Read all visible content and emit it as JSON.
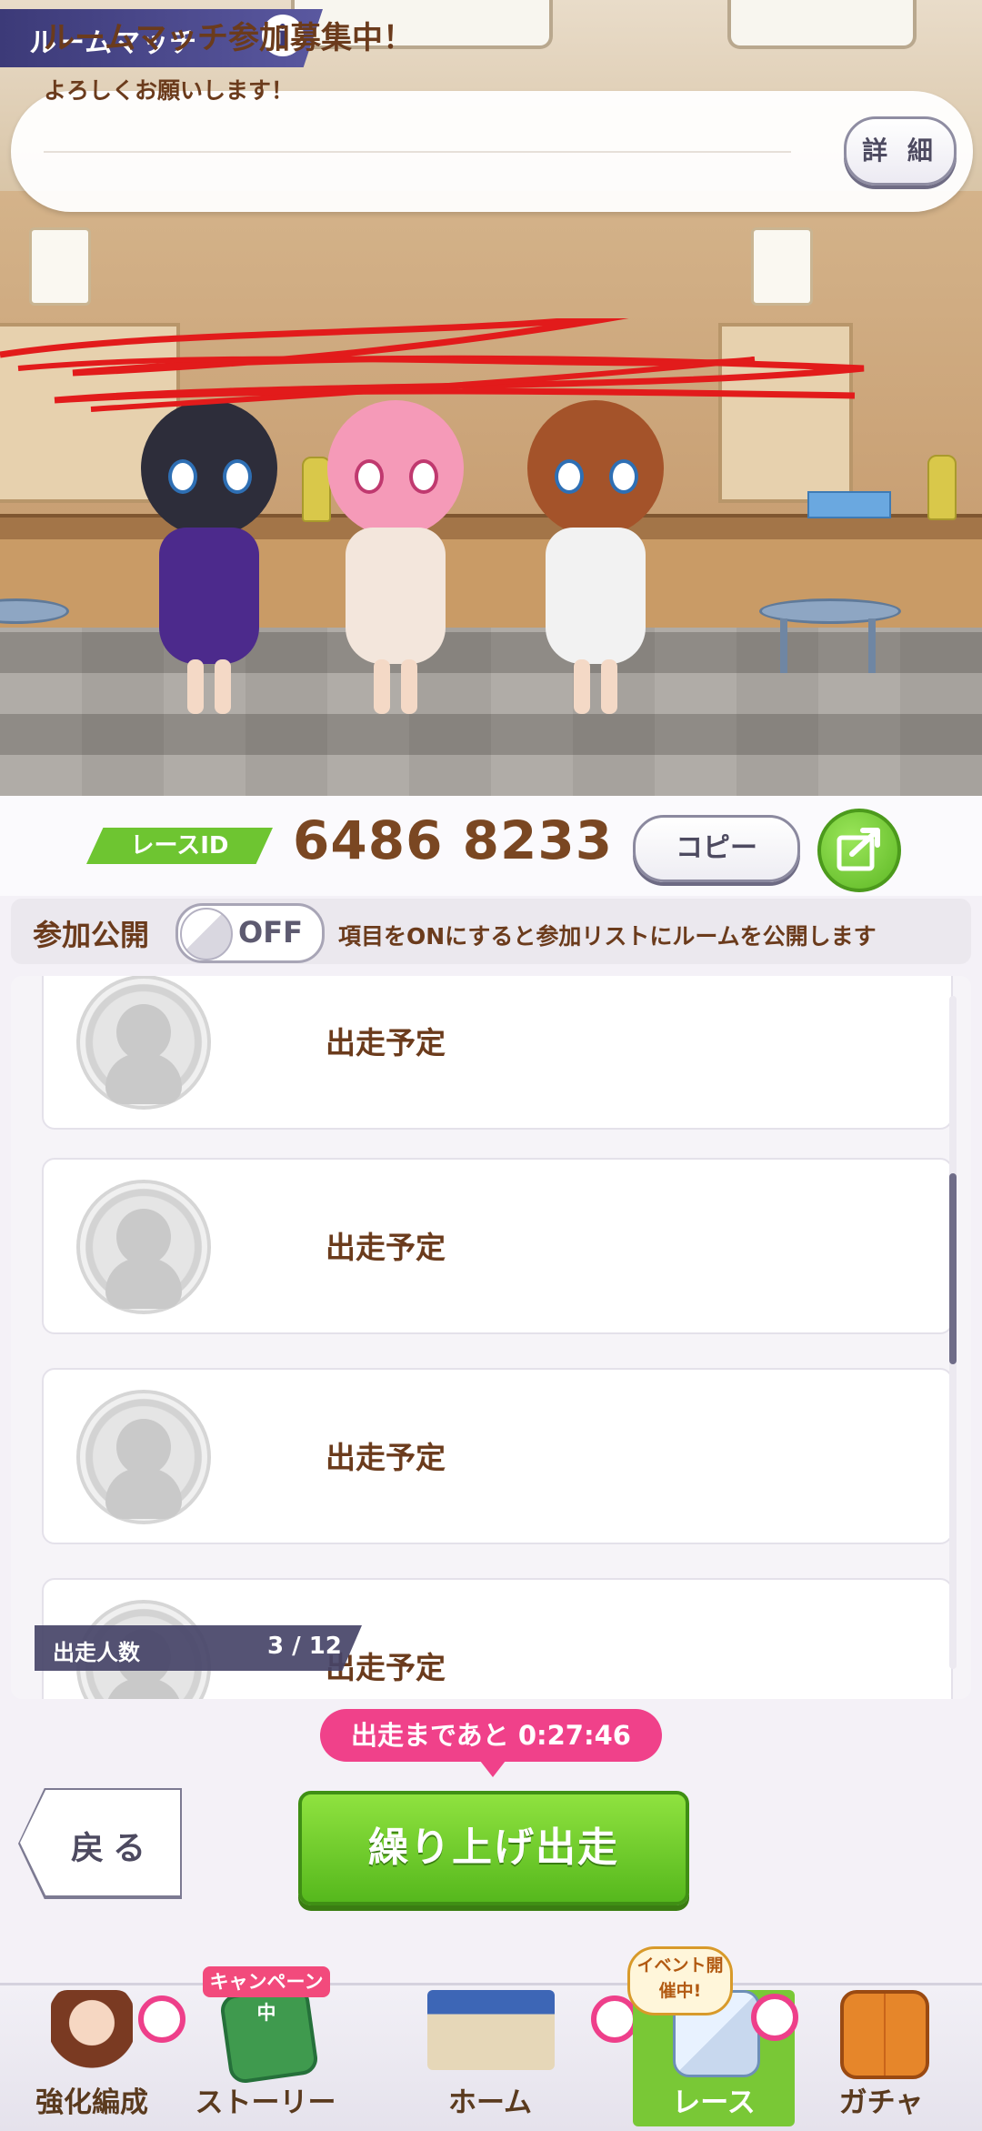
{
  "header": {
    "title": "ルームマッチ",
    "info_icon": "i"
  },
  "banner": {
    "title": "ルームマッチ参加募集中！",
    "subtitle": "よろしくお願いします！",
    "detail_label": "詳 細"
  },
  "race": {
    "id_label": "レースID",
    "id_value": "6486 8233",
    "copy_label": "コピー",
    "share_icon": "share-icon"
  },
  "public_setting": {
    "label": "参加公開",
    "toggle_state": "OFF",
    "description": "項目をONにすると参加リストにルームを公開します"
  },
  "entries": [
    {
      "label": "出走予定"
    },
    {
      "label": "出走予定"
    },
    {
      "label": "出走予定"
    },
    {
      "label": "出走予定"
    }
  ],
  "runner_count": {
    "label": "出走人数",
    "value": "3 / 12"
  },
  "timer": {
    "text": "出走まであと 0:27:46"
  },
  "actions": {
    "back_label": "戻る",
    "start_label": "繰り上げ出走"
  },
  "nav": {
    "items": [
      {
        "label": "強化編成",
        "icon": "character-icon"
      },
      {
        "label": "ストーリー",
        "icon": "book-icon",
        "tag": "キャンペーン中"
      },
      {
        "label": "ホーム",
        "icon": "school-building-icon"
      },
      {
        "label": "レース",
        "icon": "race-cards-icon",
        "tag": "イベント開催中!",
        "active": true
      },
      {
        "label": "ガチャ",
        "icon": "gacha-door-icon"
      }
    ]
  },
  "colors": {
    "accent_green": "#6ec531",
    "timer_pink": "#f0418a",
    "text_brown": "#6b3b1c",
    "title_purple": "#3c3a78"
  }
}
